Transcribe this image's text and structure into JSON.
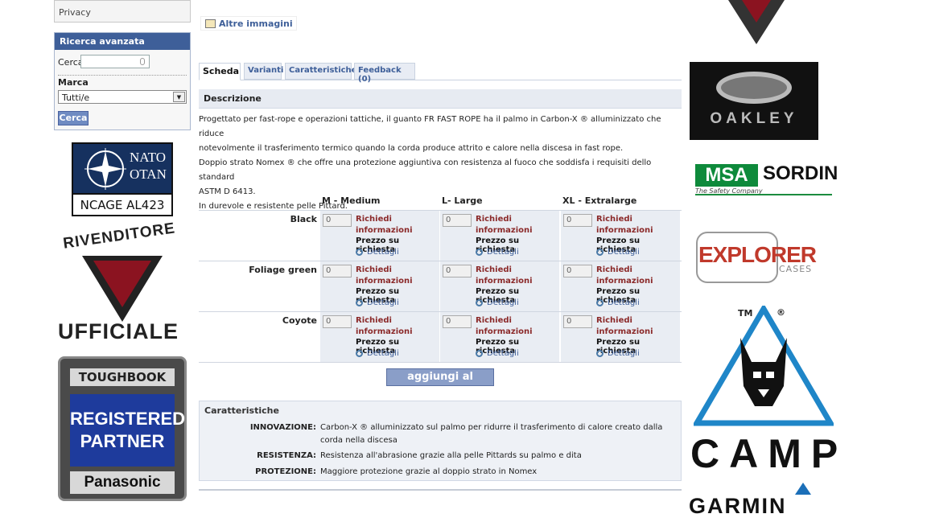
{
  "sidebar": {
    "privacy": "Privacy",
    "search": {
      "title": "Ricerca avanzata",
      "cerca_label": "Cerca",
      "cerca_value": "",
      "marca_label": "Marca",
      "marca_selected": "Tutti/e",
      "button": "Cerca"
    },
    "nato": {
      "line1": "NATO",
      "line2": "OTAN",
      "ncage": "NCAGE AL423"
    },
    "rivenditore": {
      "top": "RIVENDITORE",
      "bottom": "UFFICIALE"
    },
    "toughbook": {
      "top": "TOUGHBOOK",
      "mid": "REGISTERED PARTNER",
      "bottom": "Panasonic"
    }
  },
  "product": {
    "more_images": "Altre immagini",
    "tabs": [
      {
        "label": "Scheda"
      },
      {
        "label": "Varianti"
      },
      {
        "label": "Caratteristiche"
      },
      {
        "label": "Feedback (0)"
      }
    ],
    "description_title": "Descrizione",
    "description_lines": [
      "Progettato per fast-rope e operazioni tattiche, il guanto FR FAST ROPE ha il palmo in Carbon-X ® alluminizzato che riduce",
      "notevolmente il trasferimento termico quando la corda produce attrito e calore nella discesa in fast rope.",
      "Doppio strato Nomex ® che offre una protezione aggiuntiva con resistenza al fuoco che soddisfa i requisiti dello standard",
      "ASTM D 6413.",
      "In durevole e resistente pelle Pittard."
    ],
    "variants": {
      "sizes": [
        "M - Medium",
        "L- Large",
        "XL - Extralarge"
      ],
      "colors": [
        "Black",
        "Foliage green",
        "Coyote"
      ],
      "qty": "0",
      "request": "Richiedi informazioni",
      "price": "Prezzo su richiesta",
      "details": "Dettagli"
    },
    "add_to_cart": "aggiungi al carrello",
    "features_title": "Caratteristiche",
    "features": [
      {
        "key": "INNOVAZIONE:",
        "value": "Carbon-X ® alluminizzato sul palmo per ridurre il trasferimento di calore creato dalla corda nella discesa"
      },
      {
        "key": "RESISTENZA:",
        "value": "Resistenza all'abrasione grazie alla pelle Pittards su palmo e dita"
      },
      {
        "key": "PROTEZIONE:",
        "value": "Maggiore protezione grazie al doppio strato in Nomex"
      }
    ]
  },
  "brands": {
    "oakley": "OAKLEY",
    "msa": "MSA",
    "sordin": "SORDIN",
    "msa_sub": "The Safety Company",
    "explorer": "EXPLORER",
    "explorer_sub": "CASES",
    "camp_tm": "TM",
    "camp_r": "®",
    "camp": "CAMP",
    "garmin": "GARMIN"
  },
  "colors": {
    "accent": "#3e5f99",
    "request_red": "#8b2a2a",
    "cell_bg": "#e9edf3"
  }
}
